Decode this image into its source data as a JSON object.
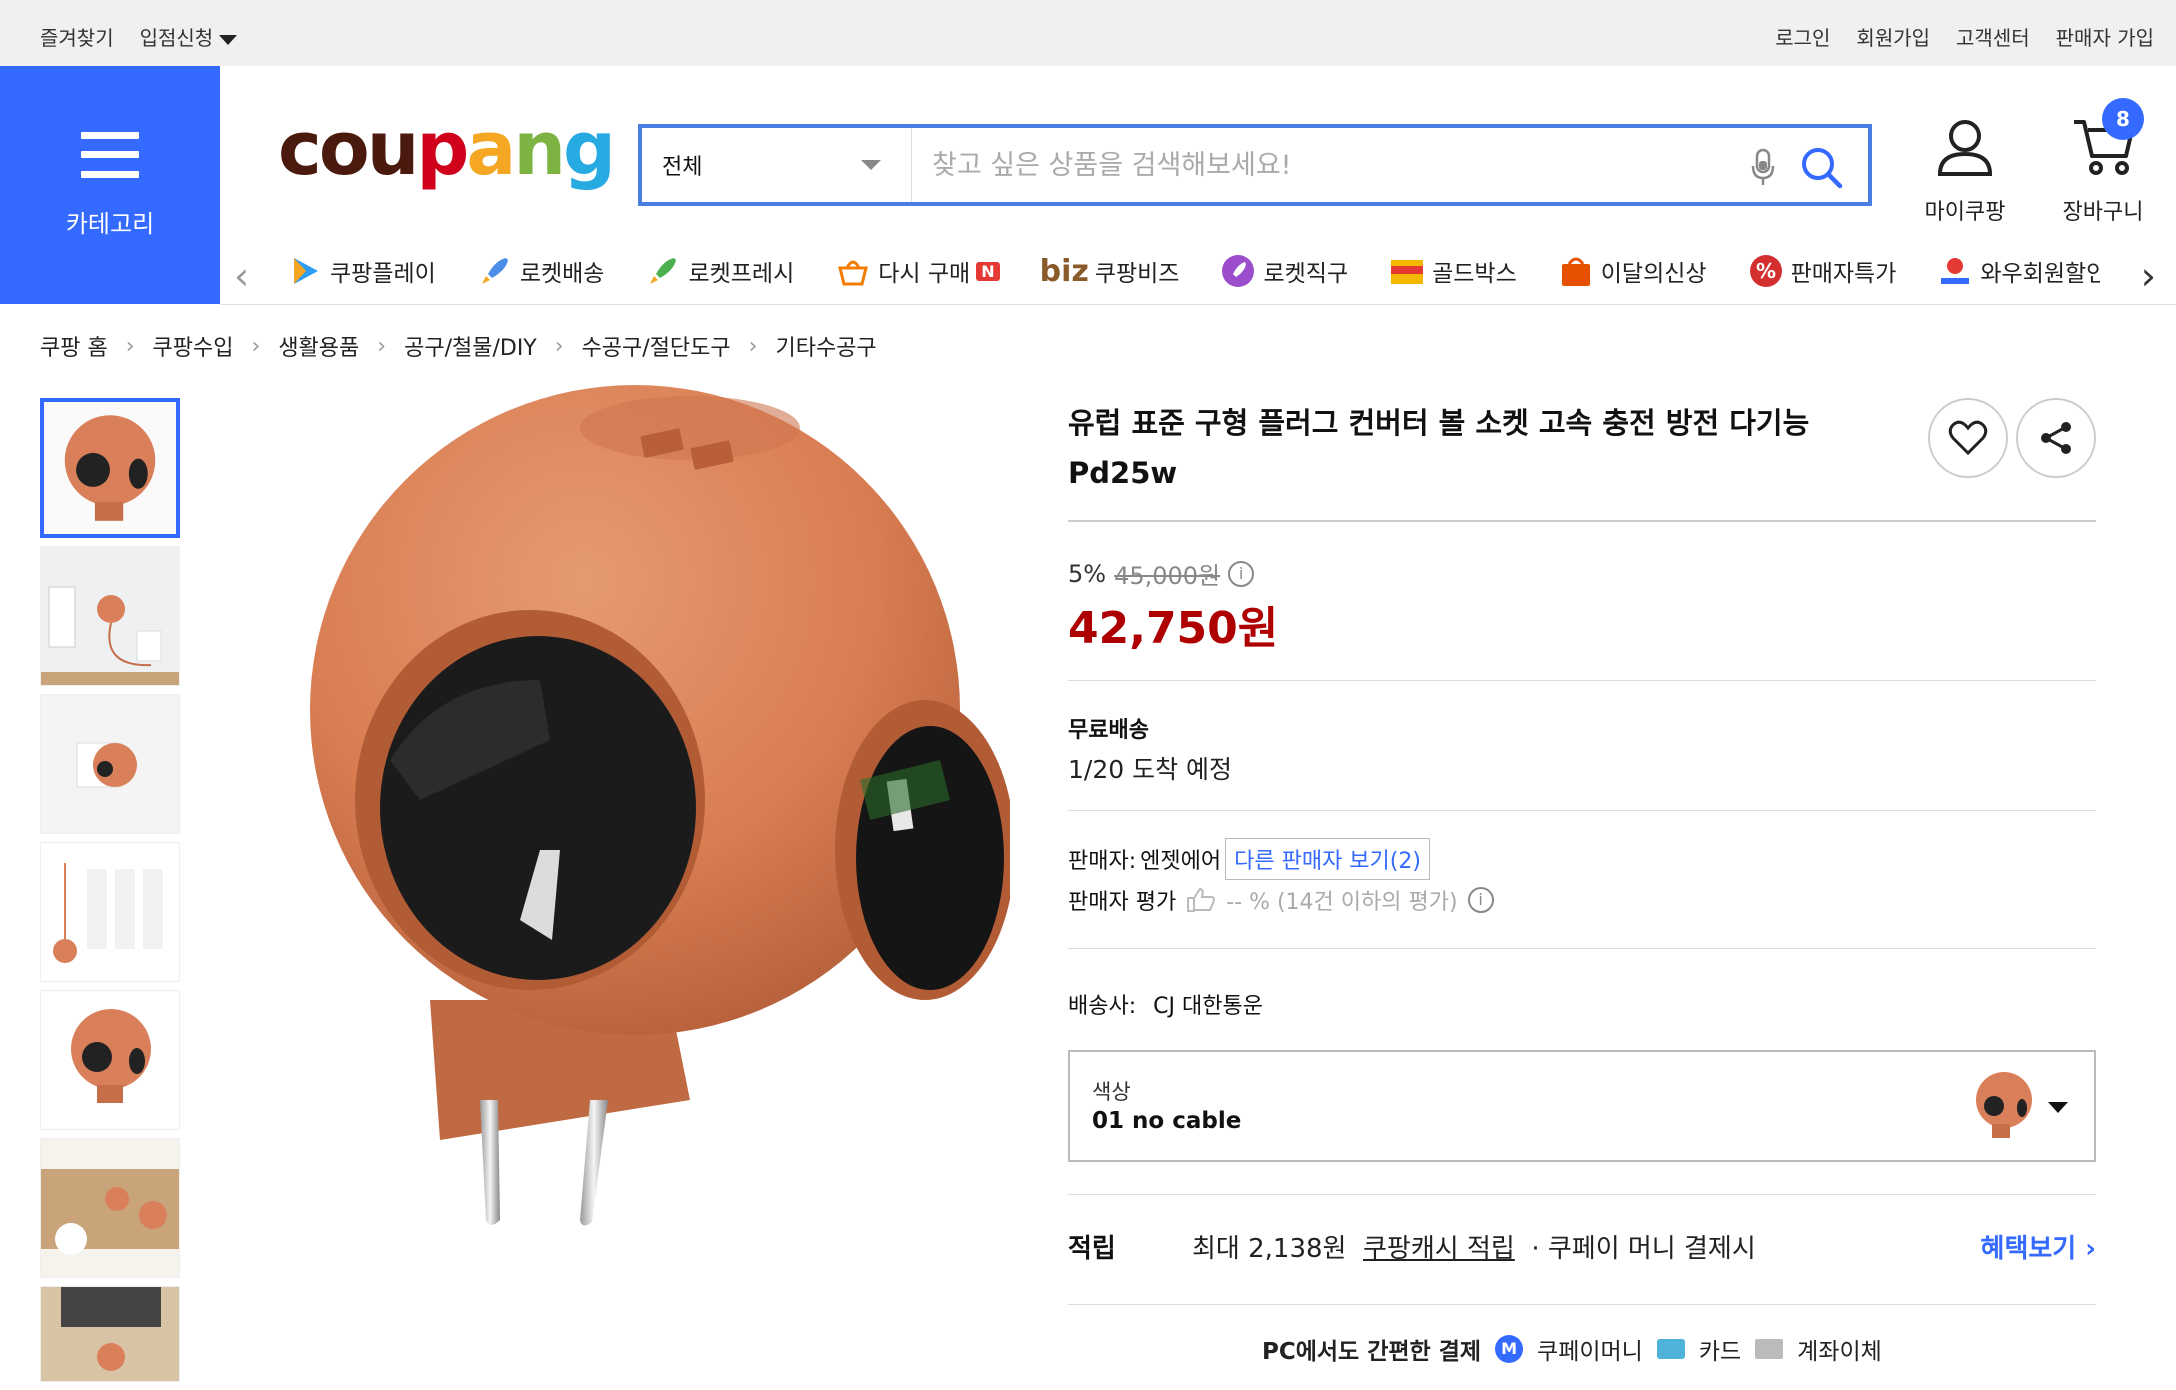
{
  "topbar": {
    "bookmark": "즐겨찾기",
    "store_apply": "입점신청",
    "login": "로그인",
    "signup": "회원가입",
    "customer_center": "고객센터",
    "seller_signup": "판매자 가입"
  },
  "header": {
    "category_label": "카테고리",
    "logo": {
      "c1": "cou",
      "c2": "p",
      "c3": "a",
      "c4": "n",
      "c5": "g"
    },
    "search_scope": "전체",
    "search_placeholder": "찾고 싶은 상품을 검색해보세요!",
    "mycoupang": "마이쿠팡",
    "cart": "장바구니",
    "cart_count": "8"
  },
  "shortcuts": [
    {
      "label": "쿠팡플레이",
      "icon": "coupang-play-icon"
    },
    {
      "label": "로켓배송",
      "icon": "rocket-icon"
    },
    {
      "label": "로켓프레시",
      "icon": "rocket-fresh-icon"
    },
    {
      "label": "다시 구매",
      "icon": "rebuy-icon",
      "badge": "N"
    },
    {
      "label": "쿠팡비즈",
      "icon": "biz-icon",
      "prefix": "biz"
    },
    {
      "label": "로켓직구",
      "icon": "rocket-direct-icon"
    },
    {
      "label": "골드박스",
      "icon": "goldbox-icon"
    },
    {
      "label": "이달의신상",
      "icon": "new-bag-icon"
    },
    {
      "label": "판매자특가",
      "icon": "seller-deal-icon"
    },
    {
      "label": "와우회원할인",
      "icon": "wow-icon"
    }
  ],
  "breadcrumb": [
    "쿠팡 홈",
    "쿠팡수입",
    "생활용품",
    "공구/철물/DIY",
    "수공구/절단도구",
    "기타수공구"
  ],
  "product": {
    "title": "유럽 표준 구형 플러그 컨버터 볼 소켓 고속 충전 방전 다기능 Pd25w",
    "discount_rate": "5%",
    "original_price": "45,000원",
    "price": "42,750원",
    "shipping_type": "무료배송",
    "arrival": "1/20 도착 예정",
    "seller_label": "판매자:",
    "seller_name": "엔젯에어",
    "other_sellers": "다른 판매자 보기(2)",
    "seller_rating_label": "판매자 평가",
    "seller_rating_value": "-- % (14건 이하의 평가)",
    "carrier_label": "배송사:",
    "carrier_name": "CJ 대한통운",
    "option_label": "색상",
    "option_value": "01 no cable",
    "reward_label": "적립",
    "reward_max": "최대 2,138원",
    "reward_link": "쿠팡캐시 적립",
    "reward_suffix": "· 쿠페이 머니 결제시",
    "reward_more": "혜택보기",
    "pay_title": "PC에서도 간편한 결제",
    "pay_money": "쿠페이머니",
    "pay_card": "카드",
    "pay_bank": "계좌이체"
  },
  "colors": {
    "accent": "#346aff",
    "price": "#ae0000",
    "product_orange": "#d9805a"
  }
}
